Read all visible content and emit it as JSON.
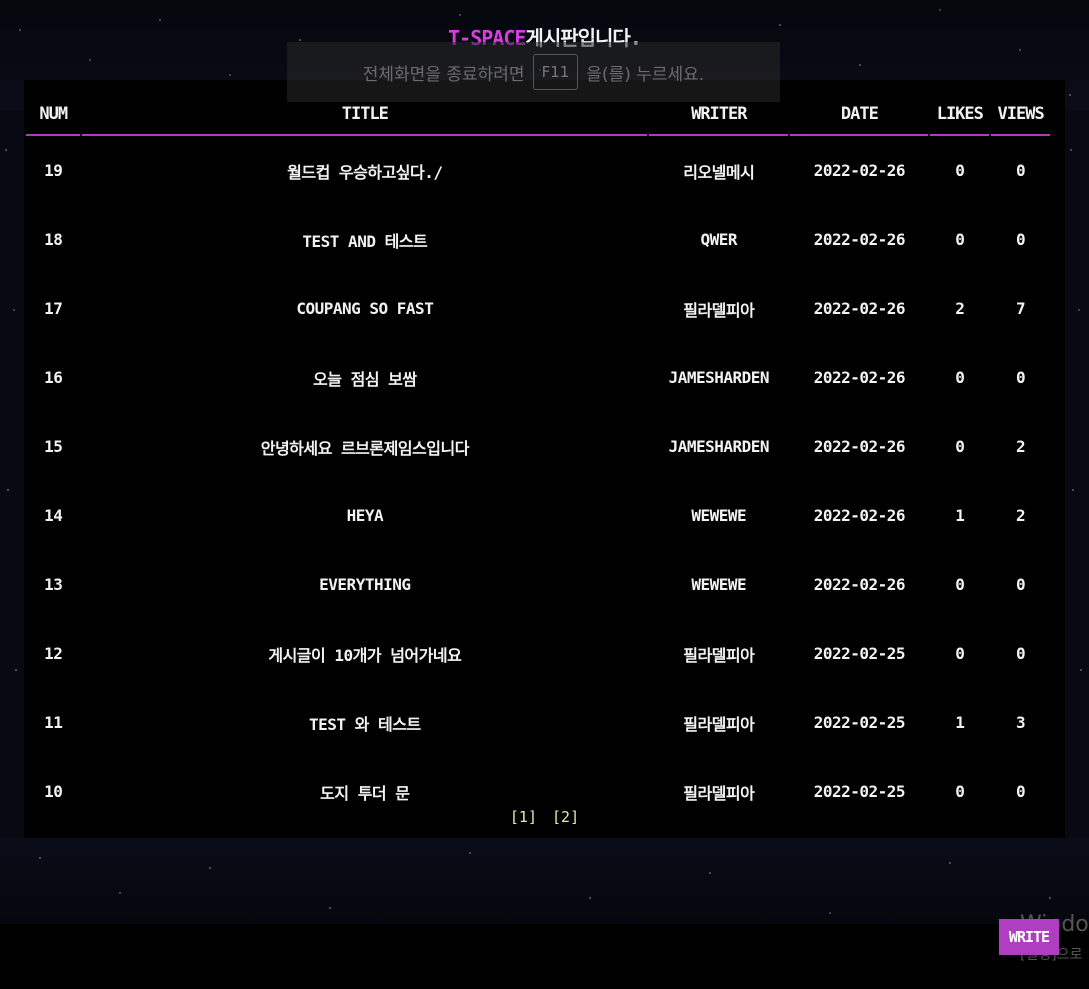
{
  "header": {
    "brand": "T-SPACE",
    "title_rest": "게시판입니다."
  },
  "fullscreen_toast": {
    "prefix": "전체화면을 종료하려면",
    "key": "F11",
    "suffix": "을(를) 누르세요."
  },
  "table": {
    "columns": [
      "NUM",
      "TITLE",
      "WRITER",
      "DATE",
      "LIKES",
      "VIEWS"
    ],
    "rows": [
      {
        "num": "19",
        "title": "월드컵 우승하고싶다./",
        "writer": "리오넬메시",
        "date": "2022-02-26",
        "likes": "0",
        "views": "0"
      },
      {
        "num": "18",
        "title": "TEST AND 테스트",
        "writer": "QWER",
        "date": "2022-02-26",
        "likes": "0",
        "views": "0"
      },
      {
        "num": "17",
        "title": "COUPANG SO FAST",
        "writer": "필라델피아",
        "date": "2022-02-26",
        "likes": "2",
        "views": "7"
      },
      {
        "num": "16",
        "title": "오늘 점심 보쌈",
        "writer": "JAMESHARDEN",
        "date": "2022-02-26",
        "likes": "0",
        "views": "0"
      },
      {
        "num": "15",
        "title": "안녕하세요 르브론제임스입니다",
        "writer": "JAMESHARDEN",
        "date": "2022-02-26",
        "likes": "0",
        "views": "2"
      },
      {
        "num": "14",
        "title": "HEYA",
        "writer": "WEWEWE",
        "date": "2022-02-26",
        "likes": "1",
        "views": "2"
      },
      {
        "num": "13",
        "title": "EVERYTHING",
        "writer": "WEWEWE",
        "date": "2022-02-26",
        "likes": "0",
        "views": "0"
      },
      {
        "num": "12",
        "title": "게시글이 10개가 넘어가네요",
        "writer": "필라델피아",
        "date": "2022-02-25",
        "likes": "0",
        "views": "0"
      },
      {
        "num": "11",
        "title": "TEST 와 테스트",
        "writer": "필라델피아",
        "date": "2022-02-25",
        "likes": "1",
        "views": "3"
      },
      {
        "num": "10",
        "title": "도지 투더 문",
        "writer": "필라델피아",
        "date": "2022-02-25",
        "likes": "0",
        "views": "0"
      }
    ]
  },
  "pagination": {
    "pages": [
      "[1]",
      "[2]"
    ]
  },
  "write_button": "WRITE",
  "os_watermark": {
    "line1": "Windo",
    "line2": "[설정]으로"
  },
  "colors": {
    "accent": "#b13bbd",
    "brand": "#d63ee0",
    "pager": "#e8e8b0"
  }
}
